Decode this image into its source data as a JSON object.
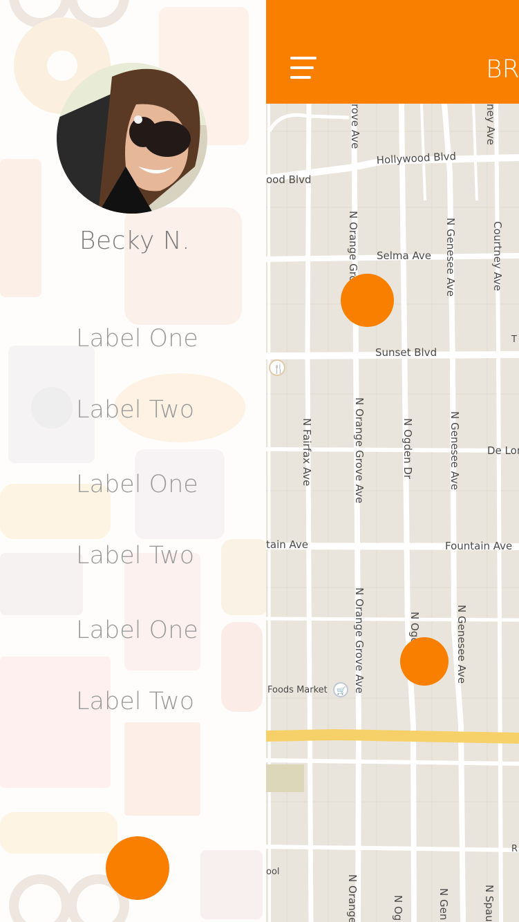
{
  "drawer": {
    "user_name": "Becky N.",
    "menu_items": [
      {
        "label": "Label One"
      },
      {
        "label": "Label Two"
      },
      {
        "label": "Label One"
      },
      {
        "label": "Label Two"
      },
      {
        "label": "Label One"
      },
      {
        "label": "Label Two"
      }
    ]
  },
  "appbar": {
    "title": "BRA",
    "menu_icon": "hamburger-icon"
  },
  "map": {
    "streets": {
      "hollywood": "Hollywood Blvd",
      "hollywood_left": "ood Blvd",
      "selma": "Selma Ave",
      "sunset": "Sunset Blvd",
      "fountain": "Fountain Ave",
      "fountain_left": "tain Ave",
      "de_long": "De Lon",
      "fairfax": "N Fairfax Ave",
      "orange_grove_top": "N Orange Gro",
      "orange_grove_mid": "N Orange Grove Ave",
      "orange_grove_low": "N Orange Grove Ave",
      "orange_grove_bottom": "N Orange",
      "ogden": "N Ogden Dr",
      "ogden_low": "N Ogd",
      "ogden_bottom": "N Og",
      "genesee_top": "N Genesee Ave",
      "genesee_mid": "N Genesee Ave",
      "genesee_low": "N Genesee Ave",
      "genesee_bottom": "N Gen",
      "courtney": "Courtney Ave",
      "grove_top": "rove Ave",
      "ney_top": "ney Ave",
      "spaulding": "N Spau",
      "foods_market": "Foods Market",
      "pool": "ool",
      "t_right": "T",
      "r_right": "R"
    },
    "accent_color": "#f97f00"
  },
  "colors": {
    "accent": "#f97f00",
    "map_background": "#e9e5dc",
    "road": "#ffffff",
    "highway": "#fcd56b"
  }
}
